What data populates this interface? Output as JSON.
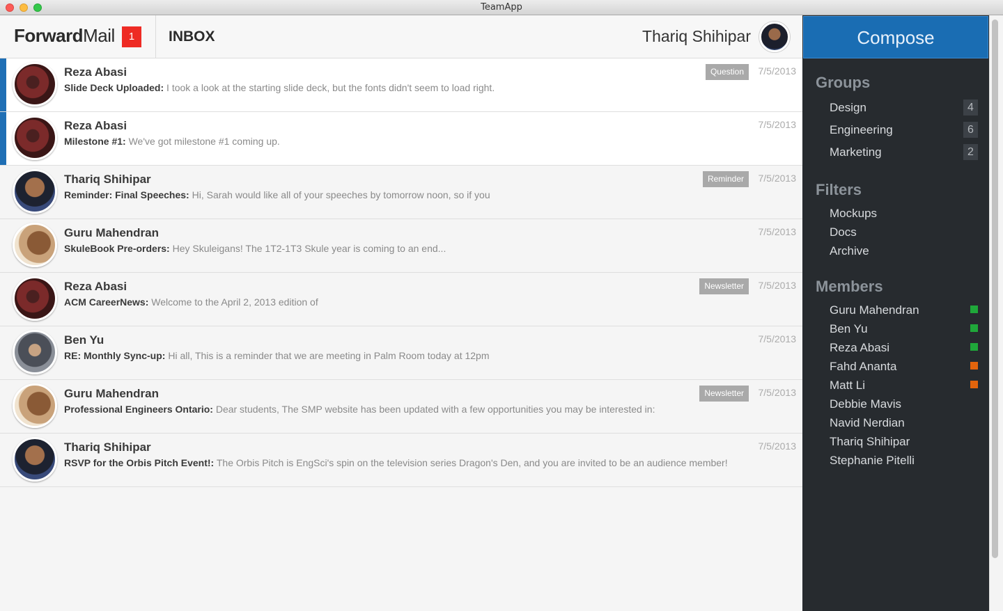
{
  "window": {
    "title": "TeamApp"
  },
  "header": {
    "brand_bold": "Forward",
    "brand_light": "Mail",
    "badge": "1",
    "section": "INBOX",
    "user_name": "Thariq Shihipar"
  },
  "messages": [
    {
      "sender": "Reza Abasi",
      "subject": "Slide Deck Uploaded:",
      "snippet": " I took a look at the starting slide deck, but the fonts didn't seem to load right.",
      "tag": "Question",
      "date": "7/5/2013",
      "unread": true
    },
    {
      "sender": "Reza Abasi",
      "subject": "Milestone #1:",
      "snippet": " We've got milestone #1 coming up.",
      "tag": "",
      "date": "7/5/2013",
      "unread": true
    },
    {
      "sender": "Thariq Shihipar",
      "subject": "Reminder: Final Speeches:",
      "snippet": " Hi, Sarah would like all of your speeches by tomorrow noon, so if you",
      "tag": "Reminder",
      "date": "7/5/2013",
      "unread": false
    },
    {
      "sender": "Guru Mahendran",
      "subject": "SkuleBook Pre-orders:",
      "snippet": " Hey Skuleigans! The 1T2-1T3 Skule year is coming to an end...",
      "tag": "",
      "date": "7/5/2013",
      "unread": false
    },
    {
      "sender": "Reza Abasi",
      "subject": "ACM CareerNews:",
      "snippet": " Welcome to the April 2, 2013 edition of",
      "tag": "Newsletter",
      "date": "7/5/2013",
      "unread": false
    },
    {
      "sender": "Ben Yu",
      "subject": "RE: Monthly Sync-up:",
      "snippet": " Hi all, This is a reminder that we are meeting in Palm Room today at 12pm",
      "tag": "",
      "date": "7/5/2013",
      "unread": false
    },
    {
      "sender": "Guru Mahendran",
      "subject": "Professional Engineers Ontario:",
      "snippet": " Dear students, The SMP website has been updated with a few opportunities you may be interested in:",
      "tag": "Newsletter",
      "date": "7/5/2013",
      "unread": false
    },
    {
      "sender": "Thariq Shihipar",
      "subject": "RSVP for the Orbis Pitch Event!:",
      "snippet": " The Orbis Pitch is EngSci's spin on the television series Dragon's Den, and you are invited to be an audience member!",
      "tag": "",
      "date": "7/5/2013",
      "unread": false
    }
  ],
  "sidebar": {
    "compose_label": "Compose",
    "groups_title": "Groups",
    "groups": [
      {
        "label": "Design",
        "count": "4"
      },
      {
        "label": "Engineering",
        "count": "6"
      },
      {
        "label": "Marketing",
        "count": "2"
      }
    ],
    "filters_title": "Filters",
    "filters": [
      {
        "label": "Mockups"
      },
      {
        "label": "Docs"
      },
      {
        "label": "Archive"
      }
    ],
    "members_title": "Members",
    "members": [
      {
        "name": "Guru Mahendran",
        "status": "online",
        "status_color": "#1fa83a"
      },
      {
        "name": "Ben Yu",
        "status": "online",
        "status_color": "#1fa83a"
      },
      {
        "name": "Reza Abasi",
        "status": "online",
        "status_color": "#1fa83a"
      },
      {
        "name": "Fahd Ananta",
        "status": "away",
        "status_color": "#e2640c"
      },
      {
        "name": "Matt Li",
        "status": "away",
        "status_color": "#e2640c"
      },
      {
        "name": "Debbie Mavis",
        "status": "offline"
      },
      {
        "name": "Navid Nerdian",
        "status": "offline"
      },
      {
        "name": "Thariq Shihipar",
        "status": "offline"
      },
      {
        "name": "Stephanie Pitelli",
        "status": "offline"
      }
    ]
  },
  "colors": {
    "accent": "#1a6db3",
    "badge": "#ee2b24",
    "sidebar_bg": "#272b2f",
    "online": "#1fa83a",
    "away": "#e2640c"
  }
}
